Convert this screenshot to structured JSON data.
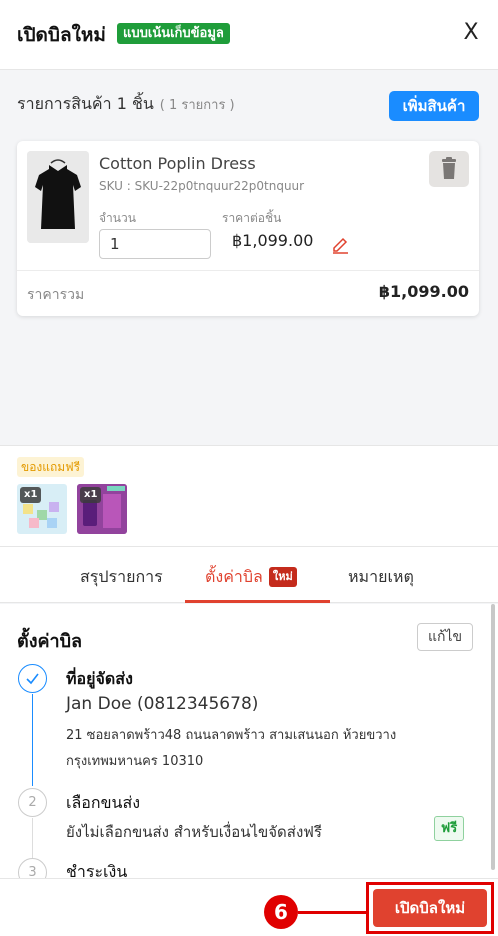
{
  "header": {
    "title": "เปิดบิลใหม่",
    "mode_badge": "แบบเน้นเก็บข้อมูล",
    "close_label": "X"
  },
  "items_section": {
    "heading": "รายการสินค้า 1 ชิ้น",
    "count": "( 1 รายการ )",
    "add_button": "เพิ่มสินค้า"
  },
  "product": {
    "name": "Cotton Poplin Dress",
    "sku": "SKU : SKU-22p0tnquur22p0tnquur",
    "qty_label": "จำนวน",
    "qty_value": "1",
    "price_label": "ราคาต่อชิ้น",
    "price": "฿1,099.00",
    "total_label": "ราคารวม",
    "total": "฿1,099.00"
  },
  "free_gifts": {
    "label": "ของแถมฟรี",
    "items": [
      {
        "qty": "x1"
      },
      {
        "qty": "x1"
      }
    ]
  },
  "tabs": [
    {
      "label": "สรุปรายการ",
      "active": false
    },
    {
      "label": "ตั้งค่าบิล",
      "active": true,
      "badge": "ใหม่"
    },
    {
      "label": "หมายเหตุ",
      "active": false
    }
  ],
  "settings": {
    "title": "ตั้งค่าบิล",
    "edit_button": "แก้ไข",
    "steps": [
      {
        "number": "1",
        "title": "ที่อยู่จัดส่ง",
        "name": "Jan Doe (0812345678)",
        "address_line1": "21 ซอยลาดพร้าว48 ถนนลาดพร้าว สามเสนนอก ห้วยขวาง",
        "address_line2": "กรุงเทพมหานคร 10310",
        "done": true
      },
      {
        "number": "2",
        "title": "เลือกขนส่ง",
        "text": "ยังไม่เลือกขนส่ง สำหรับเงื่อนไขจัดส่งฟรี",
        "badge": "ฟรี",
        "done": false
      },
      {
        "number": "3",
        "title": "ชำระเงิน",
        "done": false
      }
    ]
  },
  "footer": {
    "step_marker": "6",
    "submit_button": "เปิดบิลใหม่"
  },
  "colors": {
    "primary_red": "#e0422f",
    "blue": "#1a8cff",
    "green": "#1f9d3a",
    "annotation_red": "#e00000"
  }
}
